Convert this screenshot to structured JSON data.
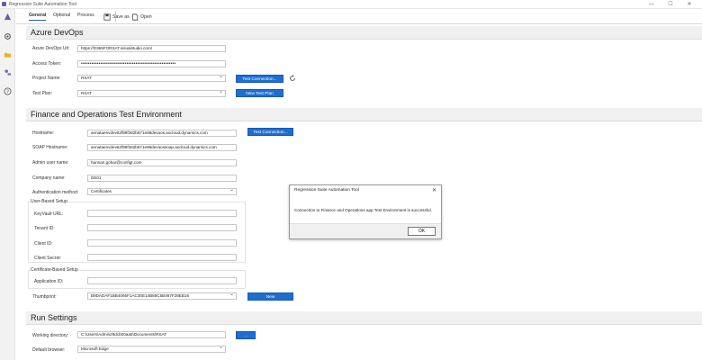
{
  "window": {
    "title": "Regression Suite Automation Tool",
    "minimize": "—",
    "maximize": "☐",
    "close": "✕"
  },
  "sidebar": {
    "items": [
      {
        "icon": "app-logo-icon"
      },
      {
        "icon": "gear-icon"
      },
      {
        "icon": "folder-icon"
      },
      {
        "icon": "tools-icon"
      },
      {
        "icon": "help-icon"
      }
    ]
  },
  "toolbar": {
    "tabs": [
      {
        "label": "General",
        "active": true
      },
      {
        "label": "Optional",
        "active": false
      },
      {
        "label": "Process",
        "active": false
      }
    ],
    "save_as": "Save as",
    "open": "Open"
  },
  "azure": {
    "header": "Azure DevOps",
    "url_label": "Azure DevOps Url:",
    "url_value": "https://D365FORSAT.visualstudio.com/",
    "token_label": "Access Token:",
    "token_value": "••••••••••••••••••••••••••••••••••••••••••••••••••••••",
    "project_label": "Project Name:",
    "project_value": "RSAT",
    "test_connection": "Test Connection...",
    "testplan_label": "Test Plan:",
    "testplan_value": "RSAT",
    "new_test_plan": "New Test Plan"
  },
  "fo": {
    "header": "Finance and Operations Test Environment",
    "hostname_label": "Hostname:",
    "hostname_value": "annataenvdev62f89f362b671e88devaos.axcloud.dynamics.com",
    "test_connection": "Test Connection...",
    "soap_label": "SOAP Hostname:",
    "soap_value": "annataenvdev62f89f362b671e88devaossoap.axcloud.dynamics.com",
    "admin_label": "Admin user name:",
    "admin_value": "hannan.gohar@configt.com",
    "company_label": "Company name:",
    "company_value": "DE01",
    "auth_label": "Authentication method:",
    "auth_value": "Certificates",
    "user_setup_label": "User-Based Setup",
    "keyvault_label": "KeyVault URL:",
    "tenant_label": "Tenant ID:",
    "client_id_label": "Client ID:",
    "client_secret_label": "Client Secret:",
    "cert_setup_label": "Certificate-Based Setup",
    "app_id_label": "Application ID:",
    "thumbprint_label": "Thumbprint:",
    "thumbprint_value": "B9DADAF1BB4065F1AC30E14B85C5B467F28EB16",
    "new_button": "New"
  },
  "run": {
    "header": "Run Settings",
    "workdir_label": "Working directory:",
    "workdir_value": "C:\\Users\\Admin29dcb00aa5\\Documents\\RSAT",
    "browse_button": "...",
    "browser_label": "Default browser:",
    "browser_value": "Microsoft Edge"
  },
  "dialog": {
    "title": "Regression Suite Automation Tool",
    "close": "✕",
    "message": "Connection to Finance and Operations app Test Environment is successful.",
    "ok": "OK"
  },
  "colors": {
    "accent": "#1e6ed1",
    "logo": "#6b5ba6",
    "folder": "#e8b51c"
  }
}
